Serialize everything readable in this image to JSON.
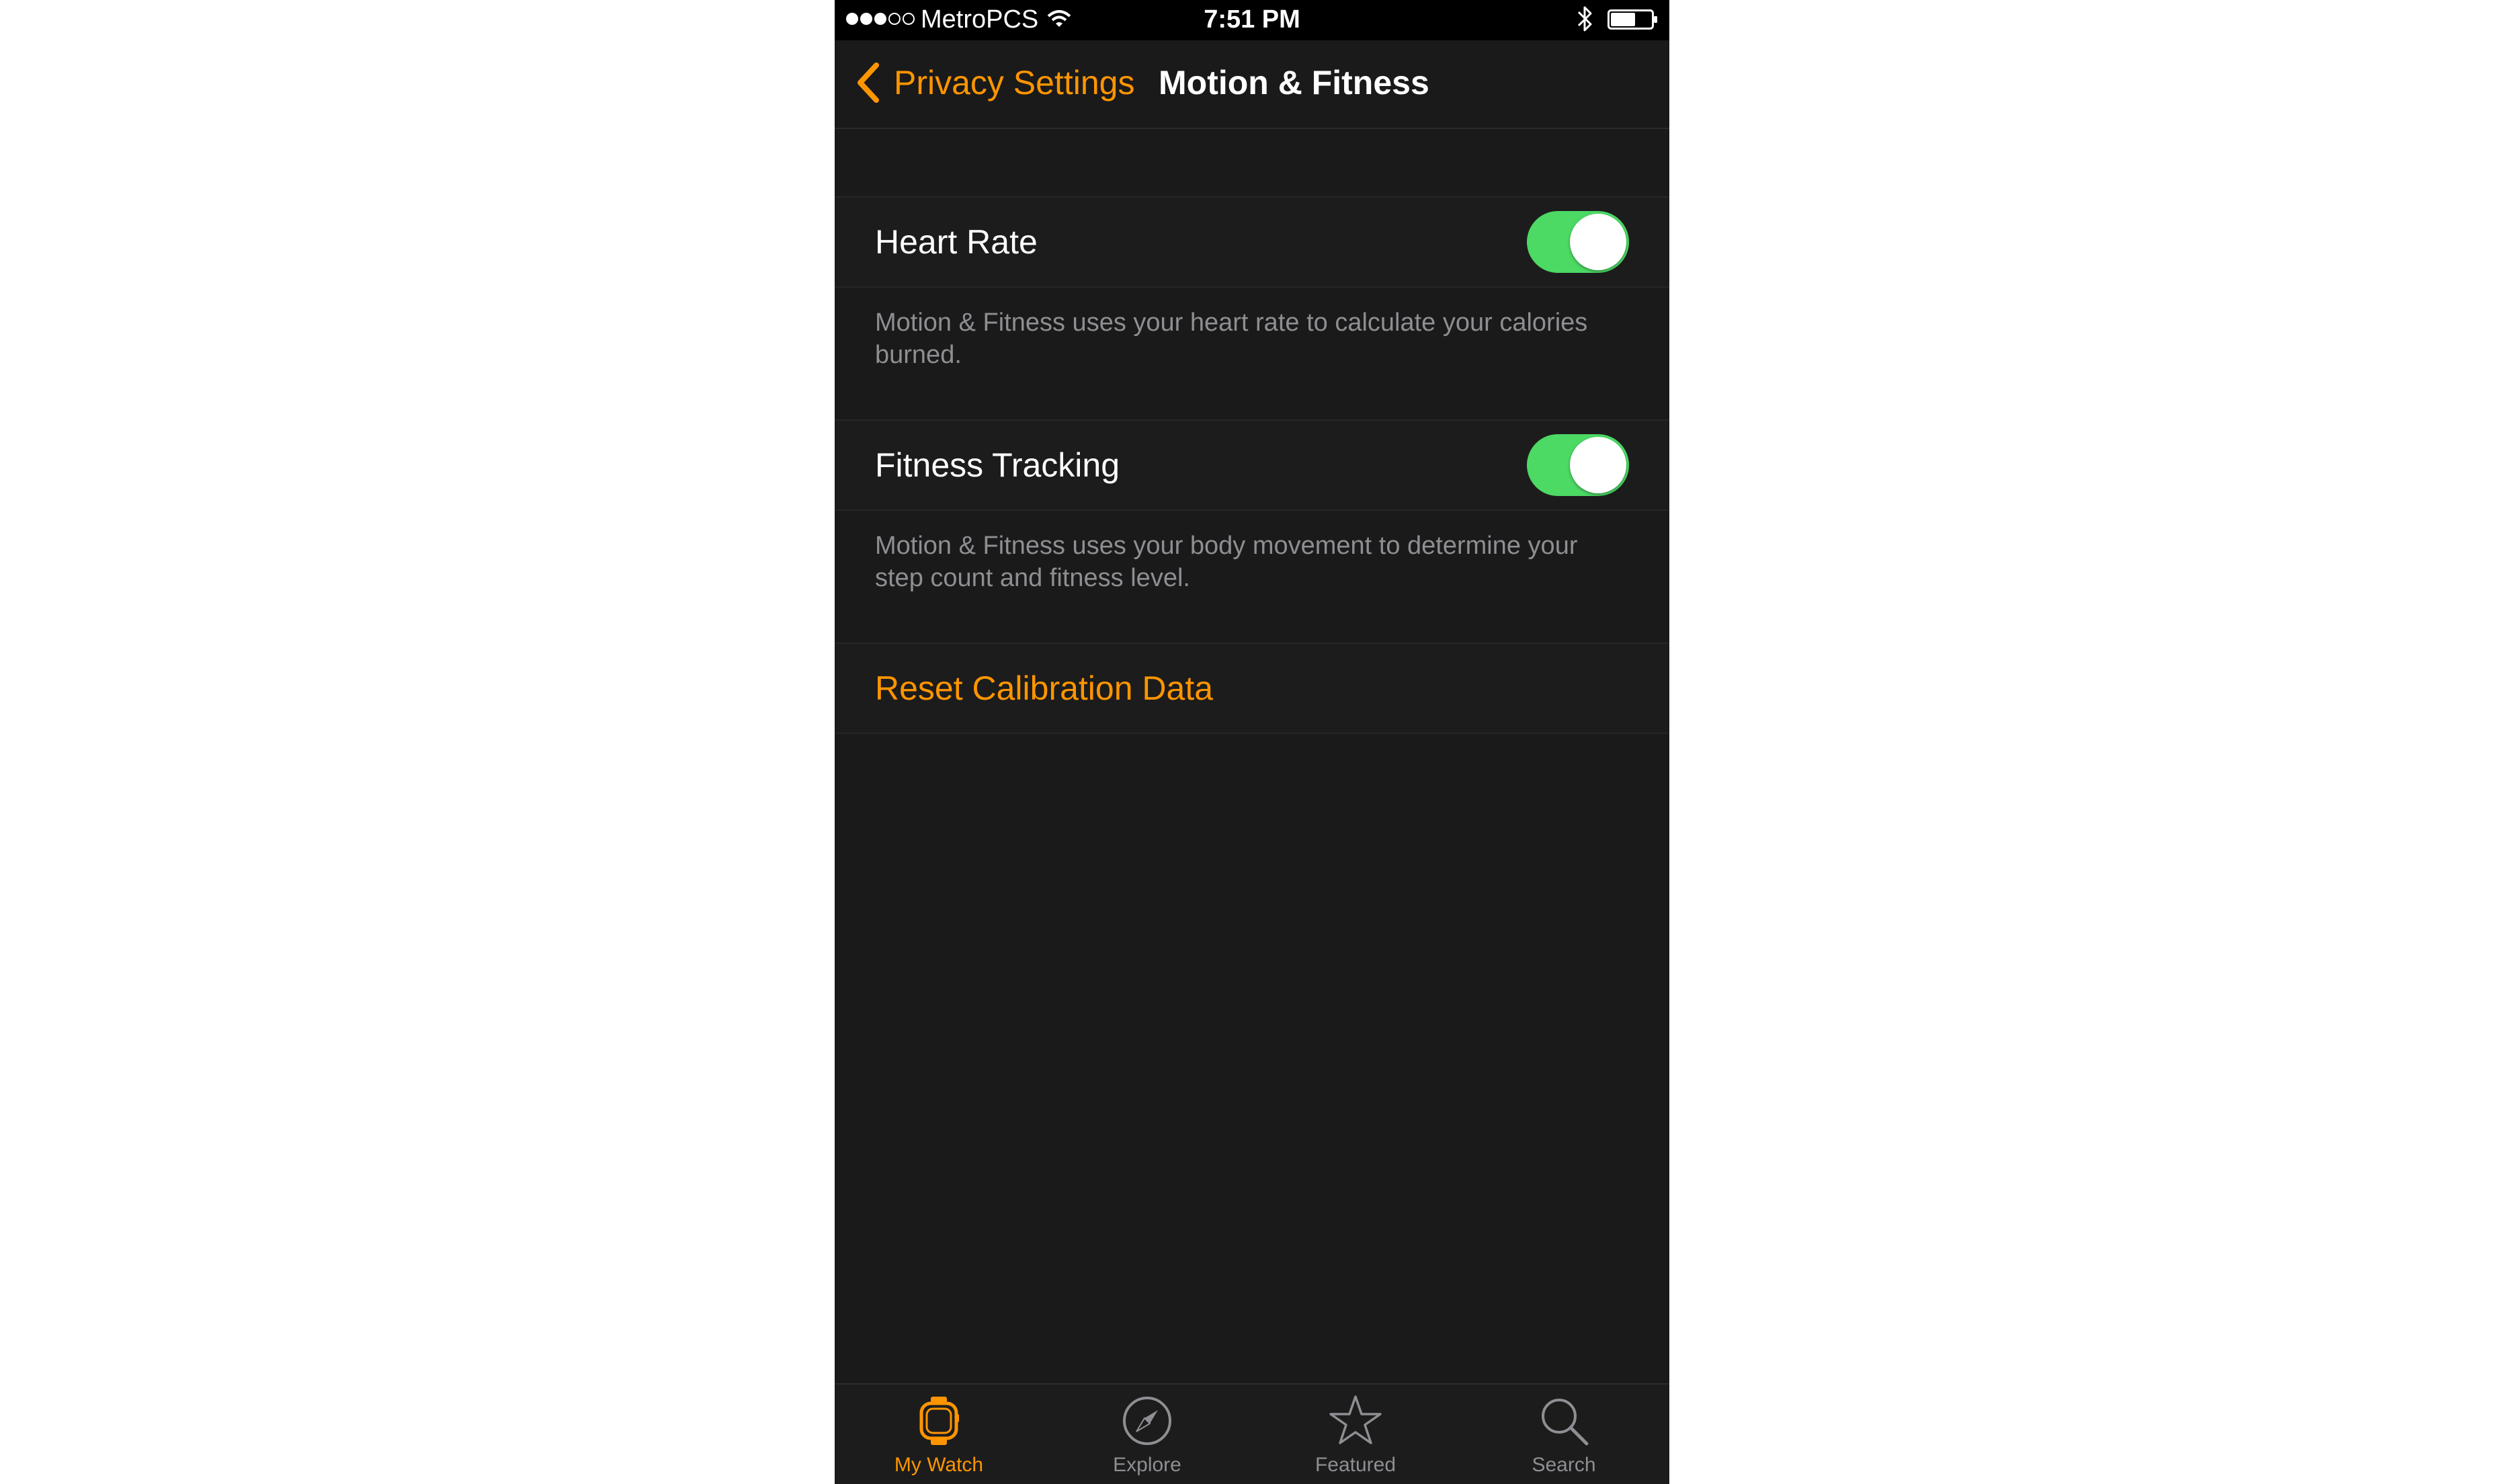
{
  "status_bar": {
    "carrier": "MetroPCS",
    "time": "7:51 PM",
    "signal_bars": 3,
    "signal_total": 5
  },
  "nav": {
    "back_label": "Privacy Settings",
    "title": "Motion & Fitness"
  },
  "settings": {
    "heart_rate": {
      "label": "Heart Rate",
      "enabled": true,
      "description": "Motion & Fitness uses your heart rate to calculate your calories burned."
    },
    "fitness_tracking": {
      "label": "Fitness Tracking",
      "enabled": true,
      "description": "Motion & Fitness uses your body movement to determine your step count and fitness level."
    },
    "reset_label": "Reset Calibration Data"
  },
  "tabs": [
    {
      "label": "My Watch",
      "icon": "watch-icon",
      "active": true
    },
    {
      "label": "Explore",
      "icon": "compass-icon",
      "active": false
    },
    {
      "label": "Featured",
      "icon": "star-icon",
      "active": false
    },
    {
      "label": "Search",
      "icon": "search-icon",
      "active": false
    }
  ],
  "colors": {
    "accent": "#ff9500",
    "toggle_on": "#4cd964",
    "background": "#1a1a1a",
    "secondary_text": "#8e8e93"
  }
}
